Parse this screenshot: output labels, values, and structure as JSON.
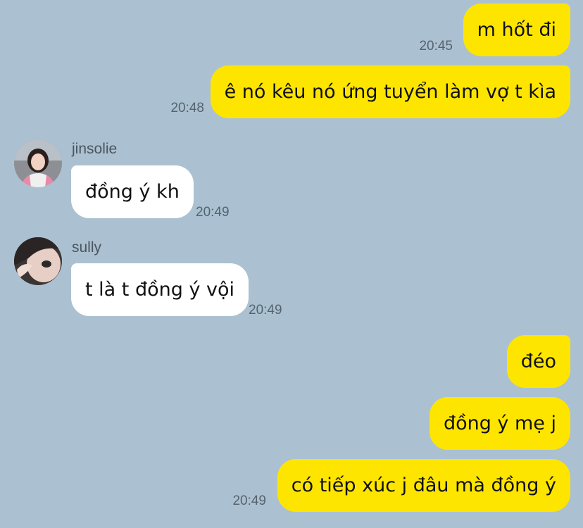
{
  "chat": {
    "messages": [
      {
        "text": "m hốt đi",
        "time": "20:45"
      },
      {
        "text": "ê nó kêu nó ứng tuyển làm vợ t kìa",
        "time": "20:48"
      },
      {
        "sender": "jinsolie",
        "text": "đồng ý kh",
        "time": "20:49"
      },
      {
        "sender": "sully",
        "text": "t là t đồng ý vội",
        "time": "20:49"
      },
      {
        "text": "đéo"
      },
      {
        "text": "đồng ý mẹ j"
      },
      {
        "text": "có tiếp xúc j đâu mà đồng ý",
        "time": "20:49"
      }
    ]
  },
  "colors": {
    "background": "#abc1d1",
    "my_bubble": "#fee500",
    "other_bubble": "#ffffff"
  }
}
